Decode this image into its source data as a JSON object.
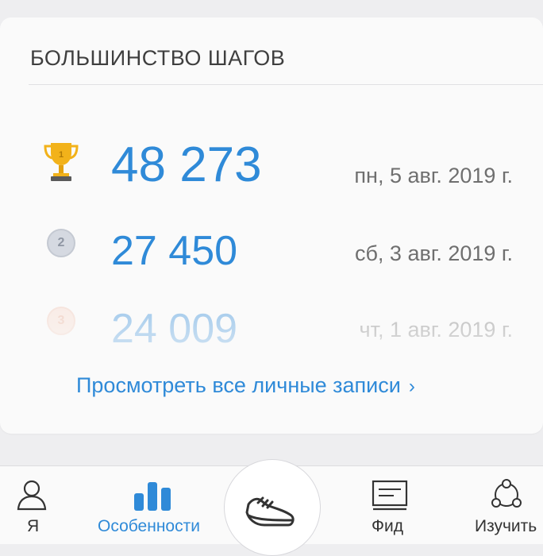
{
  "card": {
    "title": "БОЛЬШИНСТВО ШАГОВ",
    "records": [
      {
        "rank": "1",
        "steps": "48 273",
        "date": "пн, 5 авг. 2019 г."
      },
      {
        "rank": "2",
        "steps": "27 450",
        "date": "сб, 3 авг. 2019 г."
      },
      {
        "rank": "3",
        "steps": "24 009",
        "date": "чт, 1 авг. 2019 г."
      }
    ],
    "view_all_label": "Просмотреть все личные записи",
    "view_all_chevron": "›"
  },
  "tabs": [
    {
      "label": "Я",
      "icon": "person-icon"
    },
    {
      "label": "Особенности",
      "icon": "bar-chart-icon"
    },
    {
      "label": "",
      "icon": "shoe-icon"
    },
    {
      "label": "Фид",
      "icon": "feed-icon"
    },
    {
      "label": "Изучить",
      "icon": "explore-icon"
    }
  ],
  "colors": {
    "accent": "#2f8ad8",
    "gold": "#f2b21a",
    "silver": "#d5d9e1",
    "bronze": "#f7d9cc"
  }
}
